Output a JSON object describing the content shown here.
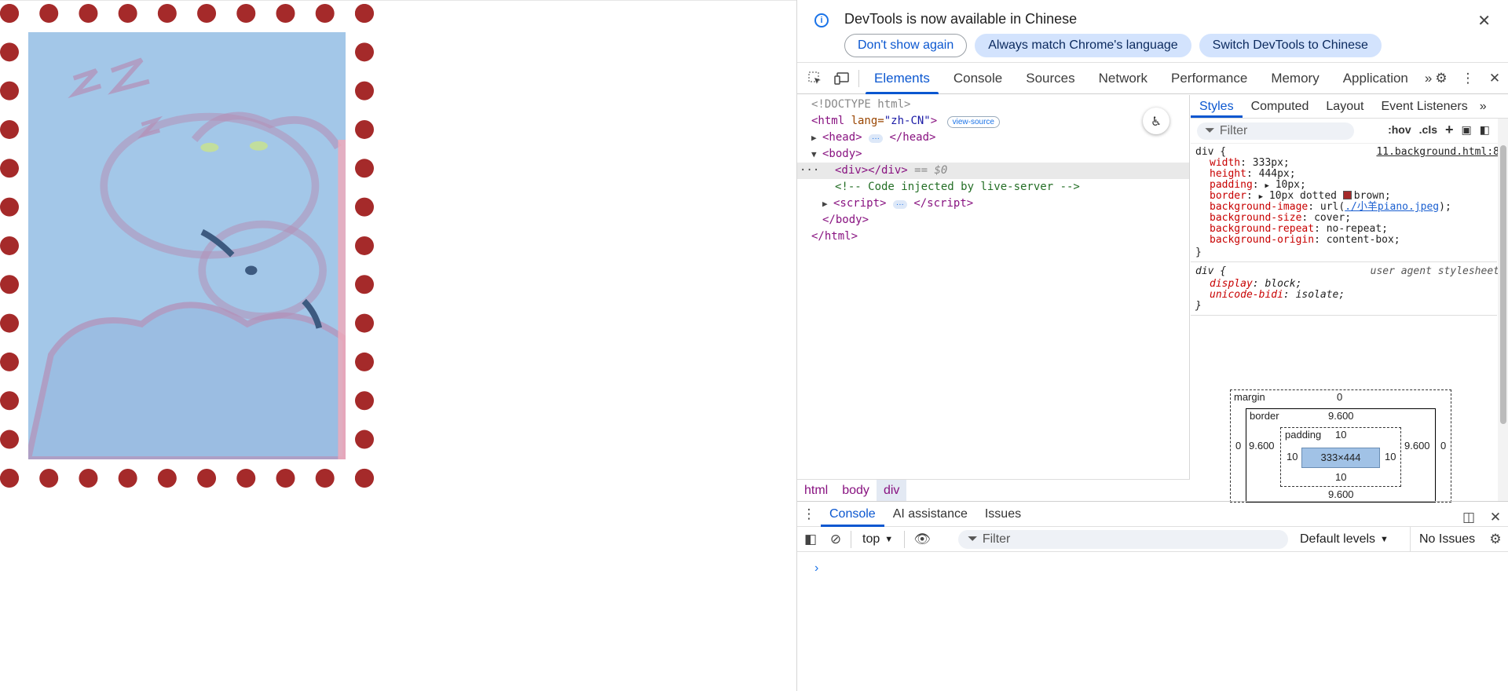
{
  "infobar": {
    "message": "DevTools is now available in Chinese",
    "btn_dont_show": "Don't show again",
    "btn_match_language": "Always match Chrome's language",
    "btn_switch": "Switch DevTools to Chinese"
  },
  "tabs": [
    "Elements",
    "Console",
    "Sources",
    "Network",
    "Performance",
    "Memory",
    "Application"
  ],
  "dom": {
    "doctype": "<!DOCTYPE html>",
    "html_lang": "\"zh-CN\"",
    "view_source": "view-source",
    "comment": "<!-- Code injected by live-server -->",
    "selected_suffix": "== $0"
  },
  "breadcrumb": [
    "html",
    "body",
    "div"
  ],
  "styles_tabs": [
    "Styles",
    "Computed",
    "Layout",
    "Event Listeners"
  ],
  "styles": {
    "filter_placeholder": "Filter",
    "hov": ":hov",
    "cls": ".cls",
    "rule_selector": "div {",
    "rule_source": "11.background.html:8",
    "props": [
      {
        "name": "width",
        "value": "333px;"
      },
      {
        "name": "height",
        "value": "444px;"
      },
      {
        "name": "padding",
        "value": "10px;"
      },
      {
        "name": "border",
        "value": "10px dotted",
        "color_name": "brown;"
      },
      {
        "name": "background-image",
        "value_prefix": "url(",
        "link": "./小羊piano.jpeg",
        "value_suffix": ");"
      },
      {
        "name": "background-size",
        "value": "cover;"
      },
      {
        "name": "background-repeat",
        "value": "no-repeat;"
      },
      {
        "name": "background-origin",
        "value": "content-box;"
      }
    ],
    "ua_selector": "div {",
    "ua_label": "user agent stylesheet",
    "ua_props": [
      {
        "name": "display",
        "value": "block;"
      },
      {
        "name": "unicode-bidi",
        "value": "isolate;"
      }
    ]
  },
  "boxmodel": {
    "margin_label": "margin",
    "margin": "0",
    "border_label": "border",
    "border": "9.600",
    "padding_label": "padding",
    "padding": "10",
    "content": "333×444"
  },
  "drawer": {
    "tabs": [
      "Console",
      "AI assistance",
      "Issues"
    ],
    "context": "top",
    "filter_placeholder": "Filter",
    "levels": "Default levels",
    "issues": "No Issues"
  },
  "colors": {
    "accent": "#0b57d0",
    "border_brown": "#a52a2a",
    "bg_blue": "#a3c7e8"
  }
}
